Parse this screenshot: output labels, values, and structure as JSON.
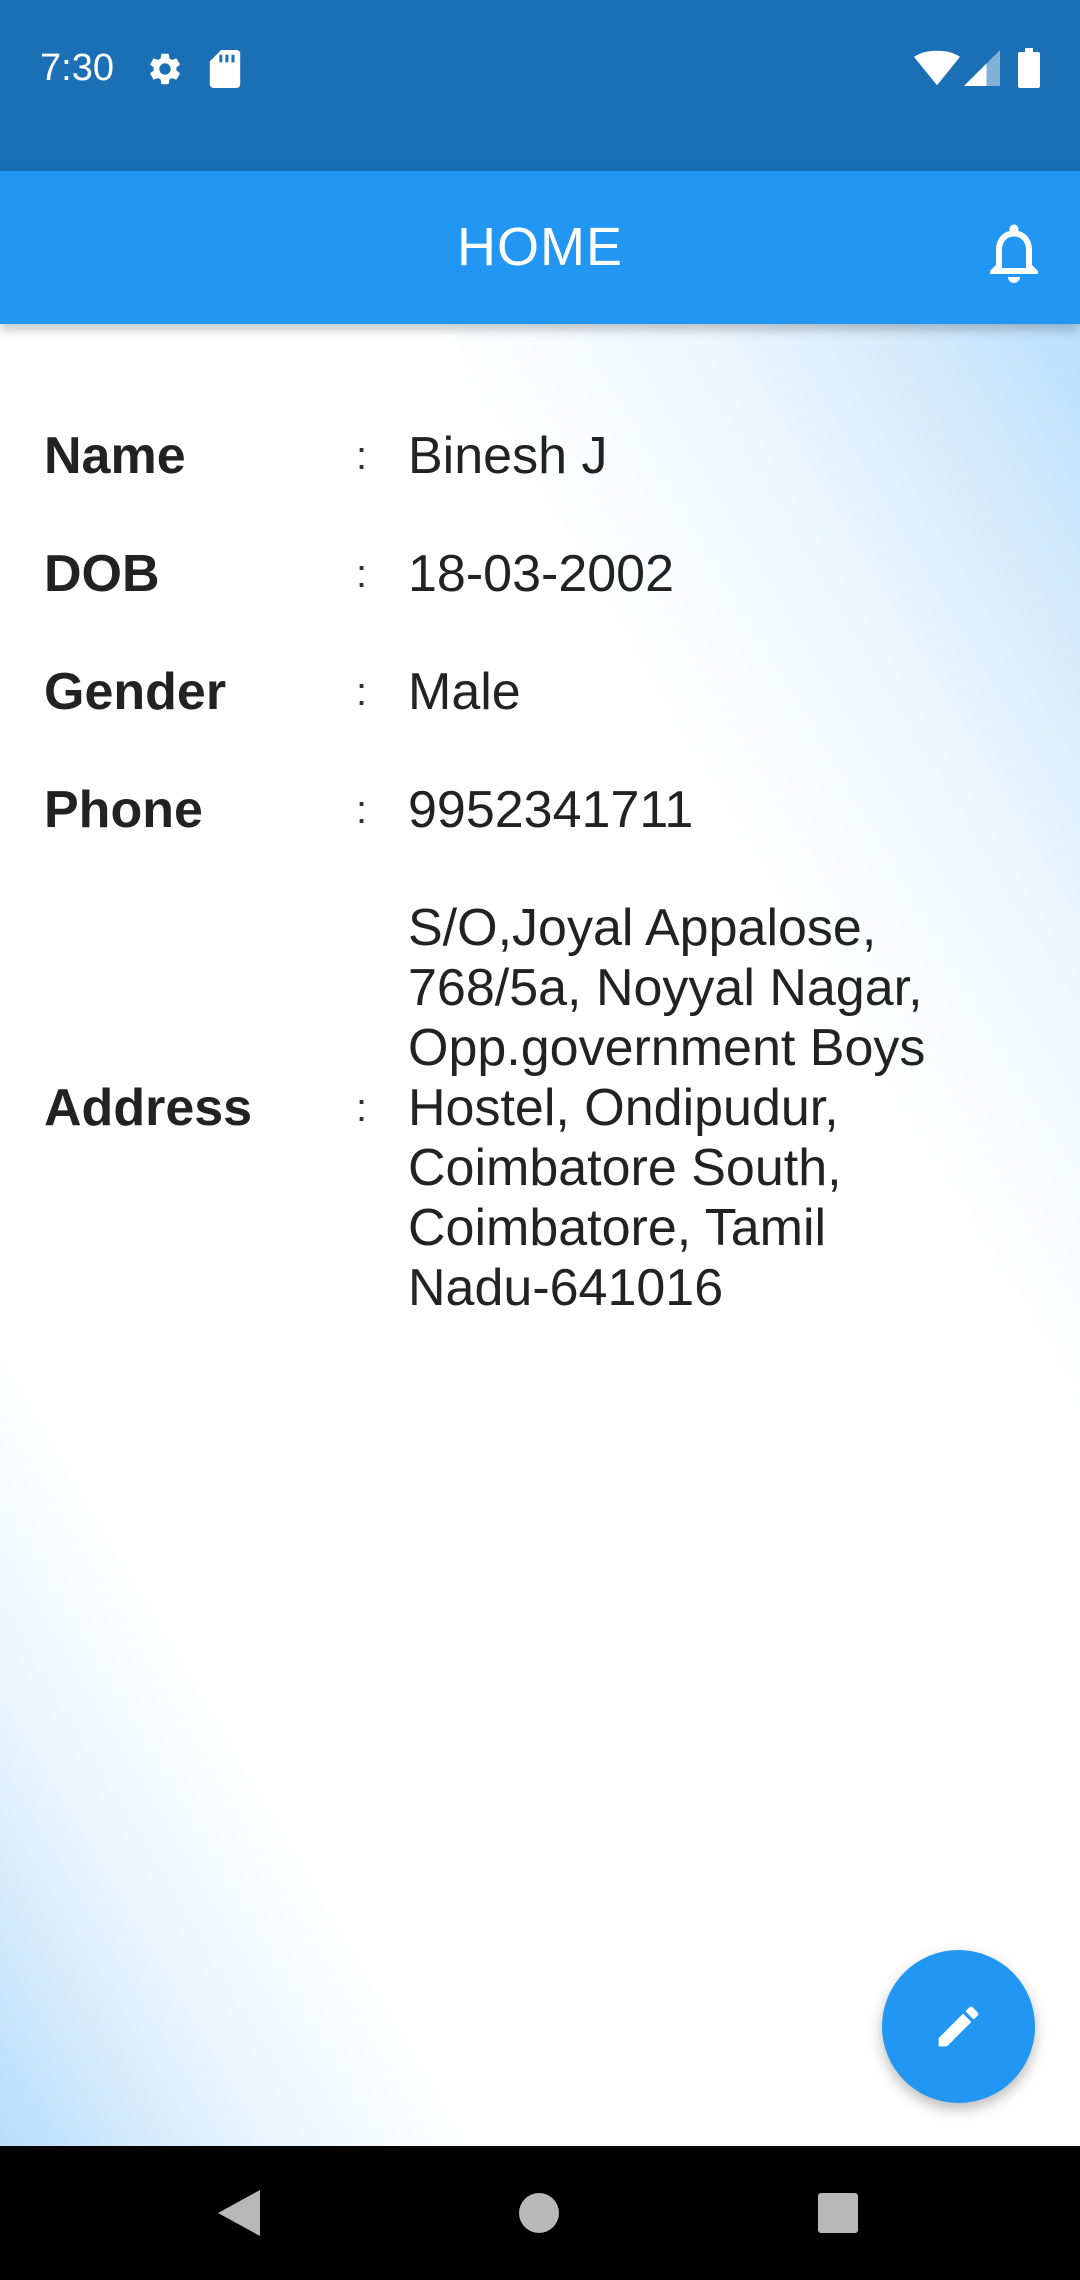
{
  "status_bar": {
    "time": "7:30",
    "icons": [
      "gear-icon",
      "sd-card-icon",
      "wifi-icon",
      "signal-icon",
      "battery-icon"
    ]
  },
  "app_bar": {
    "title": "HOME",
    "action_icon": "bell-icon"
  },
  "profile": {
    "name": {
      "label": "Name",
      "separator": ":",
      "value": "Binesh J"
    },
    "dob": {
      "label": "DOB",
      "separator": ":",
      "value": "18-03-2002"
    },
    "gender": {
      "label": "Gender",
      "separator": ":",
      "value": "Male"
    },
    "phone": {
      "label": "Phone",
      "separator": ":",
      "value": "9952341711"
    },
    "address": {
      "label": "Address",
      "separator": ":",
      "value": "S/O,Joyal Appalose,\n768/5a, Noyyal Nagar,\nOpp.government Boys\nHostel, Ondipudur,\nCoimbatore South,\nCoimbatore, Tamil\nNadu-641016"
    }
  },
  "fab": {
    "icon": "pencil-edit-icon"
  },
  "nav_bar": {
    "icons": [
      "back-icon",
      "home-icon",
      "recents-icon"
    ]
  },
  "colors": {
    "status_bar": "#1b6fb5",
    "app_bar": "#2196f3",
    "fab": "#2196f3",
    "text": "#222222",
    "nav_bar": "#000000"
  }
}
